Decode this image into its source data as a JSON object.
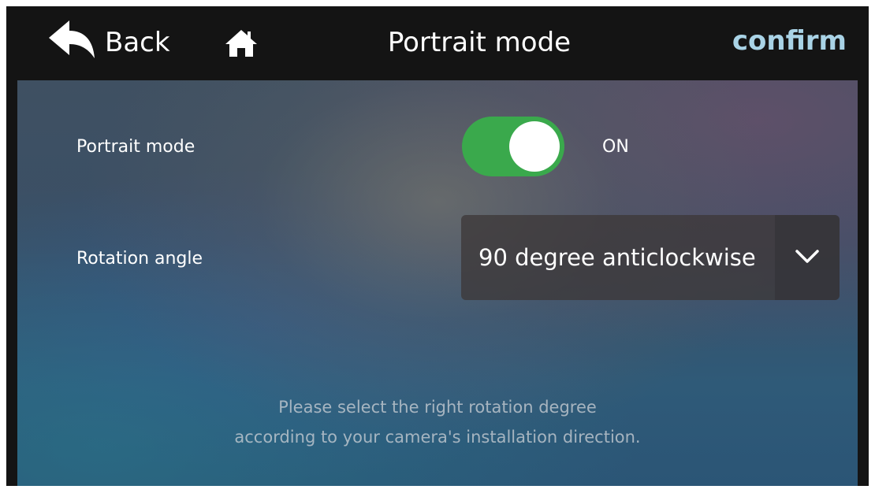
{
  "header": {
    "back_label": "Back",
    "title": "Portrait mode",
    "confirm_label": "confirm",
    "icons": {
      "back": "back-arrow-icon",
      "home": "home-icon"
    },
    "confirm_color": "#a9d3e6"
  },
  "settings": {
    "portrait_mode": {
      "label": "Portrait mode",
      "state_label": "ON",
      "on": true,
      "toggle_color": "#3aa94c"
    },
    "rotation_angle": {
      "label": "Rotation angle",
      "selected": "90 degree anticlockwise",
      "icon": "chevron-down-icon"
    }
  },
  "hint": {
    "line1": "Please select the right rotation degree",
    "line2": "according to your camera's installation direction."
  }
}
